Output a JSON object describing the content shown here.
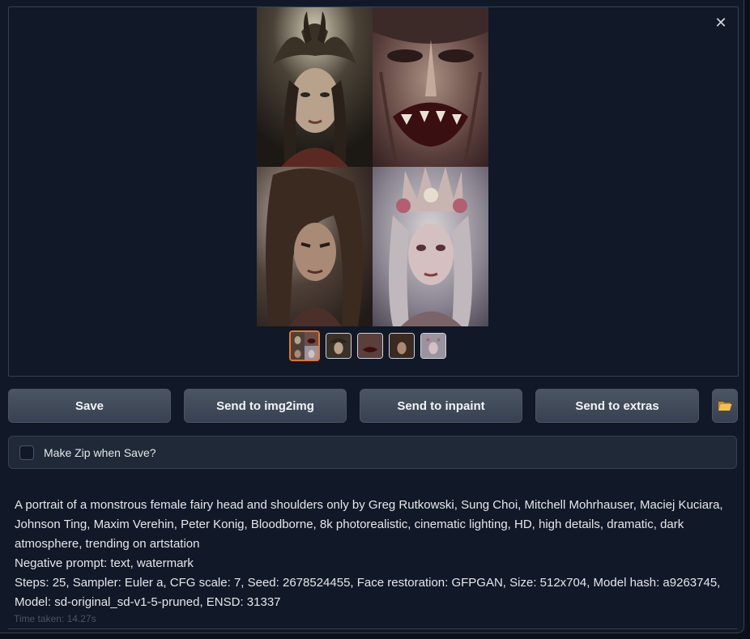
{
  "gallery": {
    "close_icon": "close-icon",
    "main_image_alt": "2x2 grid of generated fantasy portraits",
    "thumbnail_count": 5,
    "selected_thumbnail": 1
  },
  "buttons": {
    "save": "Save",
    "send_img2img": "Send to img2img",
    "send_inpaint": "Send to inpaint",
    "send_extras": "Send to extras",
    "open_folder_icon": "folder-icon"
  },
  "zip": {
    "label": "Make Zip when Save?",
    "checked": false
  },
  "generation_info": {
    "prompt": "A portrait of a monstrous female fairy head and shoulders only by Greg Rutkowski, Sung Choi, Mitchell Mohrhauser, Maciej Kuciara, Johnson Ting, Maxim Verehin, Peter Konig, Bloodborne, 8k photorealistic, cinematic lighting, HD, high details, dramatic, dark atmosphere, trending on artstation",
    "negative_prompt": "Negative prompt: text, watermark",
    "parameters": "Steps: 25, Sampler: Euler a, CFG scale: 7, Seed: 2678524455, Face restoration: GFPGAN, Size: 512x704, Model hash: a9263745, Model: sd-original_sd-v1-5-pruned, ENSD: 31337",
    "time_taken": "Time taken: 14.27s"
  },
  "colors": {
    "background": "#0b0f19",
    "panel": "#111827",
    "border": "#374151",
    "button": "#4b5563",
    "selected_thumb": "#f97316"
  }
}
